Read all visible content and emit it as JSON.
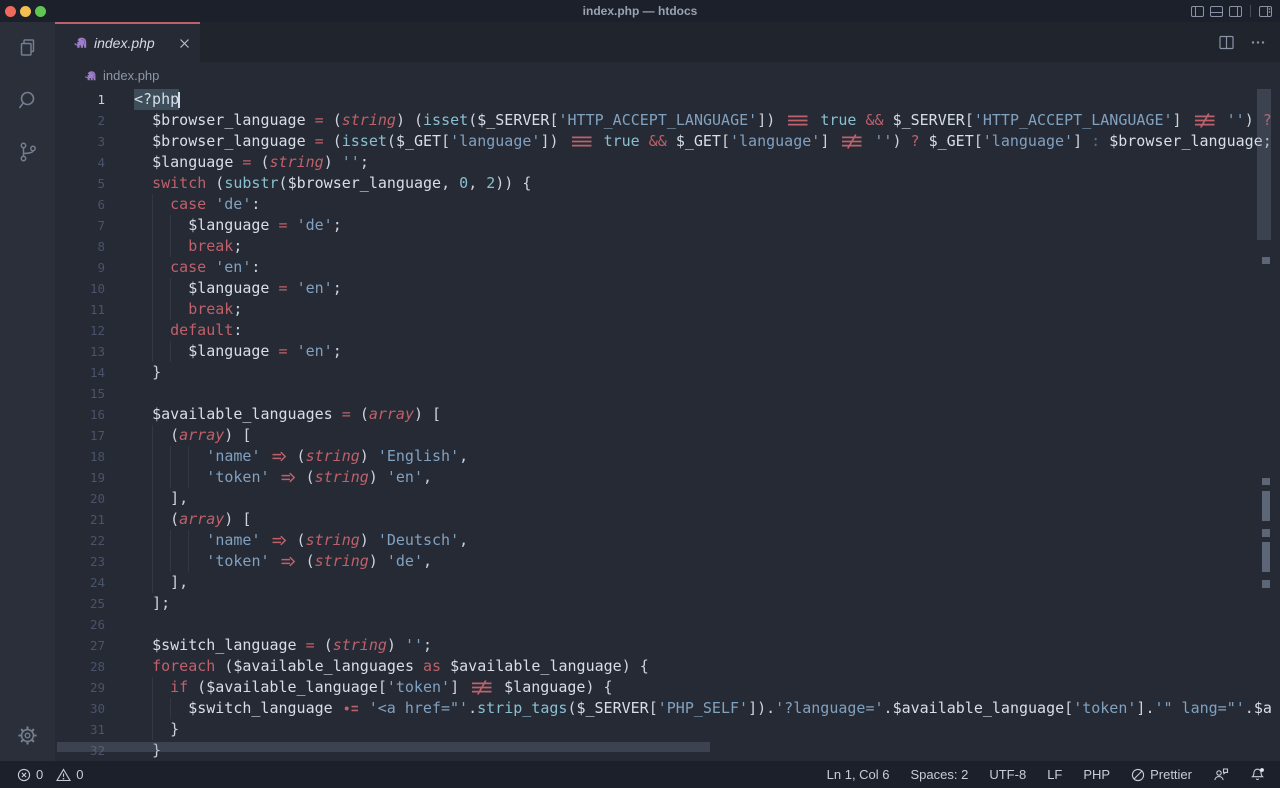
{
  "window": {
    "title": "index.php — htdocs"
  },
  "activity_bar": {
    "items": [
      "explorer",
      "search",
      "source-control"
    ],
    "bottom": "settings"
  },
  "tab": {
    "label": "index.php",
    "icon": "php-elephant"
  },
  "breadcrumb": {
    "label": "index.php"
  },
  "editor": {
    "active_line": 1,
    "language": "php"
  },
  "code": {
    "lines": [
      {
        "n": 1,
        "ind": 0,
        "t": [
          [
            "tag",
            "<?php"
          ]
        ]
      },
      {
        "n": 2,
        "ind": 2,
        "t": [
          [
            "v",
            "$browser_language"
          ],
          [
            "o",
            " = "
          ],
          [
            "p",
            "("
          ],
          [
            "cast",
            "string"
          ],
          [
            "p",
            ") ("
          ],
          [
            "f",
            "isset"
          ],
          [
            "p",
            "("
          ],
          [
            "v",
            "$_SERVER"
          ],
          [
            "p",
            "["
          ],
          [
            "s",
            "'HTTP_ACCEPT_LANGUAGE'"
          ],
          [
            "p",
            "]) "
          ],
          [
            "lig",
            "eq3"
          ],
          [
            "p",
            " "
          ],
          [
            "f",
            "true"
          ],
          [
            "p",
            " "
          ],
          [
            "o",
            "&&"
          ],
          [
            "p",
            " "
          ],
          [
            "v",
            "$_SERVER"
          ],
          [
            "p",
            "["
          ],
          [
            "s",
            "'HTTP_ACCEPT_LANGUAGE'"
          ],
          [
            "p",
            "] "
          ],
          [
            "lig",
            "neq3"
          ],
          [
            "p",
            " "
          ],
          [
            "s",
            "''"
          ],
          [
            "p",
            ") "
          ],
          [
            "o",
            "?"
          ]
        ]
      },
      {
        "n": 3,
        "ind": 2,
        "t": [
          [
            "v",
            "$browser_language"
          ],
          [
            "o",
            " = "
          ],
          [
            "p",
            "("
          ],
          [
            "f",
            "isset"
          ],
          [
            "p",
            "("
          ],
          [
            "v",
            "$_GET"
          ],
          [
            "p",
            "["
          ],
          [
            "s",
            "'language'"
          ],
          [
            "p",
            "]) "
          ],
          [
            "lig",
            "eq3"
          ],
          [
            "p",
            " "
          ],
          [
            "f",
            "true"
          ],
          [
            "p",
            " "
          ],
          [
            "o",
            "&&"
          ],
          [
            "p",
            " "
          ],
          [
            "v",
            "$_GET"
          ],
          [
            "p",
            "["
          ],
          [
            "s",
            "'language'"
          ],
          [
            "p",
            "] "
          ],
          [
            "lig",
            "neq3"
          ],
          [
            "p",
            " "
          ],
          [
            "s",
            "''"
          ],
          [
            "p",
            ") "
          ],
          [
            "o",
            "?"
          ],
          [
            "p",
            " "
          ],
          [
            "v",
            "$_GET"
          ],
          [
            "p",
            "["
          ],
          [
            "s",
            "'language'"
          ],
          [
            "p",
            "] "
          ],
          [
            "d",
            ":"
          ],
          [
            "p",
            " "
          ],
          [
            "v",
            "$browser_language"
          ],
          [
            "p",
            ";"
          ]
        ]
      },
      {
        "n": 4,
        "ind": 2,
        "t": [
          [
            "v",
            "$language"
          ],
          [
            "o",
            " = "
          ],
          [
            "p",
            "("
          ],
          [
            "cast",
            "string"
          ],
          [
            "p",
            ") "
          ],
          [
            "s",
            "''"
          ],
          [
            "p",
            ";"
          ]
        ]
      },
      {
        "n": 5,
        "ind": 2,
        "t": [
          [
            "k",
            "switch"
          ],
          [
            "p",
            " ("
          ],
          [
            "f",
            "substr"
          ],
          [
            "p",
            "("
          ],
          [
            "v",
            "$browser_language"
          ],
          [
            "p",
            ", "
          ],
          [
            "n",
            "0"
          ],
          [
            "p",
            ", "
          ],
          [
            "n",
            "2"
          ],
          [
            "p",
            ")) {"
          ]
        ]
      },
      {
        "n": 6,
        "ind": 4,
        "t": [
          [
            "k",
            "case"
          ],
          [
            "p",
            " "
          ],
          [
            "s",
            "'de'"
          ],
          [
            "p",
            ":"
          ]
        ]
      },
      {
        "n": 7,
        "ind": 6,
        "t": [
          [
            "v",
            "$language"
          ],
          [
            "o",
            " = "
          ],
          [
            "s",
            "'de'"
          ],
          [
            "p",
            ";"
          ]
        ]
      },
      {
        "n": 8,
        "ind": 6,
        "t": [
          [
            "k",
            "break"
          ],
          [
            "p",
            ";"
          ]
        ]
      },
      {
        "n": 9,
        "ind": 4,
        "t": [
          [
            "k",
            "case"
          ],
          [
            "p",
            " "
          ],
          [
            "s",
            "'en'"
          ],
          [
            "p",
            ":"
          ]
        ]
      },
      {
        "n": 10,
        "ind": 6,
        "t": [
          [
            "v",
            "$language"
          ],
          [
            "o",
            " = "
          ],
          [
            "s",
            "'en'"
          ],
          [
            "p",
            ";"
          ]
        ]
      },
      {
        "n": 11,
        "ind": 6,
        "t": [
          [
            "k",
            "break"
          ],
          [
            "p",
            ";"
          ]
        ]
      },
      {
        "n": 12,
        "ind": 4,
        "t": [
          [
            "k",
            "default"
          ],
          [
            "p",
            ":"
          ]
        ]
      },
      {
        "n": 13,
        "ind": 6,
        "t": [
          [
            "v",
            "$language"
          ],
          [
            "o",
            " = "
          ],
          [
            "s",
            "'en'"
          ],
          [
            "p",
            ";"
          ]
        ]
      },
      {
        "n": 14,
        "ind": 2,
        "t": [
          [
            "p",
            "}"
          ]
        ]
      },
      {
        "n": 15,
        "ind": 0,
        "t": []
      },
      {
        "n": 16,
        "ind": 2,
        "t": [
          [
            "v",
            "$available_languages"
          ],
          [
            "o",
            " = "
          ],
          [
            "p",
            "("
          ],
          [
            "cast",
            "array"
          ],
          [
            "p",
            ") ["
          ]
        ]
      },
      {
        "n": 17,
        "ind": 4,
        "t": [
          [
            "p",
            "("
          ],
          [
            "cast",
            "array"
          ],
          [
            "p",
            ") ["
          ]
        ]
      },
      {
        "n": 18,
        "ind": 8,
        "t": [
          [
            "s",
            "'name'"
          ],
          [
            "p",
            " "
          ],
          [
            "lig",
            "arrow2"
          ],
          [
            "p",
            " ("
          ],
          [
            "cast",
            "string"
          ],
          [
            "p",
            ") "
          ],
          [
            "s",
            "'English'"
          ],
          [
            "p",
            ","
          ]
        ]
      },
      {
        "n": 19,
        "ind": 8,
        "t": [
          [
            "s",
            "'token'"
          ],
          [
            "p",
            " "
          ],
          [
            "lig",
            "arrow2"
          ],
          [
            "p",
            " ("
          ],
          [
            "cast",
            "string"
          ],
          [
            "p",
            ") "
          ],
          [
            "s",
            "'en'"
          ],
          [
            "p",
            ","
          ]
        ]
      },
      {
        "n": 20,
        "ind": 4,
        "t": [
          [
            "p",
            "],"
          ]
        ]
      },
      {
        "n": 21,
        "ind": 4,
        "t": [
          [
            "p",
            "("
          ],
          [
            "cast",
            "array"
          ],
          [
            "p",
            ") ["
          ]
        ]
      },
      {
        "n": 22,
        "ind": 8,
        "t": [
          [
            "s",
            "'name'"
          ],
          [
            "p",
            " "
          ],
          [
            "lig",
            "arrow2"
          ],
          [
            "p",
            " ("
          ],
          [
            "cast",
            "string"
          ],
          [
            "p",
            ") "
          ],
          [
            "s",
            "'Deutsch'"
          ],
          [
            "p",
            ","
          ]
        ]
      },
      {
        "n": 23,
        "ind": 8,
        "t": [
          [
            "s",
            "'token'"
          ],
          [
            "p",
            " "
          ],
          [
            "lig",
            "arrow2"
          ],
          [
            "p",
            " ("
          ],
          [
            "cast",
            "string"
          ],
          [
            "p",
            ") "
          ],
          [
            "s",
            "'de'"
          ],
          [
            "p",
            ","
          ]
        ]
      },
      {
        "n": 24,
        "ind": 4,
        "t": [
          [
            "p",
            "],"
          ]
        ]
      },
      {
        "n": 25,
        "ind": 2,
        "t": [
          [
            "p",
            "];"
          ]
        ]
      },
      {
        "n": 26,
        "ind": 0,
        "t": []
      },
      {
        "n": 27,
        "ind": 2,
        "t": [
          [
            "v",
            "$switch_language"
          ],
          [
            "o",
            " = "
          ],
          [
            "p",
            "("
          ],
          [
            "cast",
            "string"
          ],
          [
            "p",
            ") "
          ],
          [
            "s",
            "''"
          ],
          [
            "p",
            ";"
          ]
        ]
      },
      {
        "n": 28,
        "ind": 2,
        "t": [
          [
            "k",
            "foreach"
          ],
          [
            "p",
            " ("
          ],
          [
            "v",
            "$available_languages"
          ],
          [
            "k",
            " as "
          ],
          [
            "v",
            "$available_language"
          ],
          [
            "p",
            ") {"
          ]
        ]
      },
      {
        "n": 29,
        "ind": 4,
        "t": [
          [
            "k",
            "if"
          ],
          [
            "p",
            " ("
          ],
          [
            "v",
            "$available_language"
          ],
          [
            "p",
            "["
          ],
          [
            "s",
            "'token'"
          ],
          [
            "p",
            "] "
          ],
          [
            "lig",
            "neq3"
          ],
          [
            "p",
            " "
          ],
          [
            "v",
            "$language"
          ],
          [
            "p",
            ") {"
          ]
        ]
      },
      {
        "n": 30,
        "ind": 6,
        "t": [
          [
            "v",
            "$switch_language"
          ],
          [
            "p",
            " "
          ],
          [
            "lig",
            "doteq"
          ],
          [
            "p",
            " "
          ],
          [
            "s",
            "'<a href=\"'"
          ],
          [
            "p",
            "."
          ],
          [
            "f",
            "strip_tags"
          ],
          [
            "p",
            "("
          ],
          [
            "v",
            "$_SERVER"
          ],
          [
            "p",
            "["
          ],
          [
            "s",
            "'PHP_SELF'"
          ],
          [
            "p",
            "])"
          ],
          [
            "p",
            "."
          ],
          [
            "s",
            "'?language='"
          ],
          [
            "p",
            "."
          ],
          [
            "v",
            "$available_language"
          ],
          [
            "p",
            "["
          ],
          [
            "s",
            "'token'"
          ],
          [
            "p",
            "]"
          ],
          [
            "p",
            "."
          ],
          [
            "s",
            "'\" lang=\"'"
          ],
          [
            "p",
            "."
          ],
          [
            "v",
            "$a"
          ]
        ]
      },
      {
        "n": 31,
        "ind": 4,
        "t": [
          [
            "p",
            "}"
          ]
        ]
      },
      {
        "n": 32,
        "ind": 2,
        "t": [
          [
            "p",
            "}"
          ]
        ]
      }
    ]
  },
  "status_bar": {
    "errors": "0",
    "warnings": "0",
    "cursor": "Ln 1, Col 6",
    "indent": "Spaces: 2",
    "encoding": "UTF-8",
    "eol": "LF",
    "language": "PHP",
    "formatter": "Prettier"
  },
  "colors": {
    "accent": "#bf616a",
    "string": "#81a1c1",
    "function": "#88c0d0",
    "fg": "#d8dee9",
    "editor_bg": "#252a34"
  }
}
